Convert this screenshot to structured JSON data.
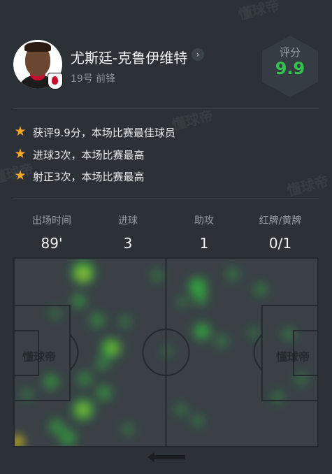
{
  "player": {
    "name": "尤斯廷-克鲁伊维特",
    "meta": "19号 前锋",
    "avatar_icon": "player-avatar",
    "club_icon": "bournemouth-badge-icon"
  },
  "rating": {
    "label": "评分",
    "value": "9.9",
    "color": "#33c24d"
  },
  "highlights": [
    {
      "icon": "star-icon",
      "text": "获评9.9分，本场比赛最佳球员"
    },
    {
      "icon": "star-icon",
      "text": "进球3次，本场比赛最高"
    },
    {
      "icon": "star-icon",
      "text": "射正3次，本场比赛最高"
    }
  ],
  "stats": [
    {
      "label": "出场时间",
      "value": "89'"
    },
    {
      "label": "进球",
      "value": "3"
    },
    {
      "label": "助攻",
      "value": "1"
    },
    {
      "label": "红牌/黄牌",
      "value": "0/1"
    }
  ],
  "watermark": "懂球帝",
  "heatmap_colors": [
    "#2fbf3c",
    "#d8c41a"
  ],
  "nav": {
    "back_icon": "back-arrow-icon"
  }
}
